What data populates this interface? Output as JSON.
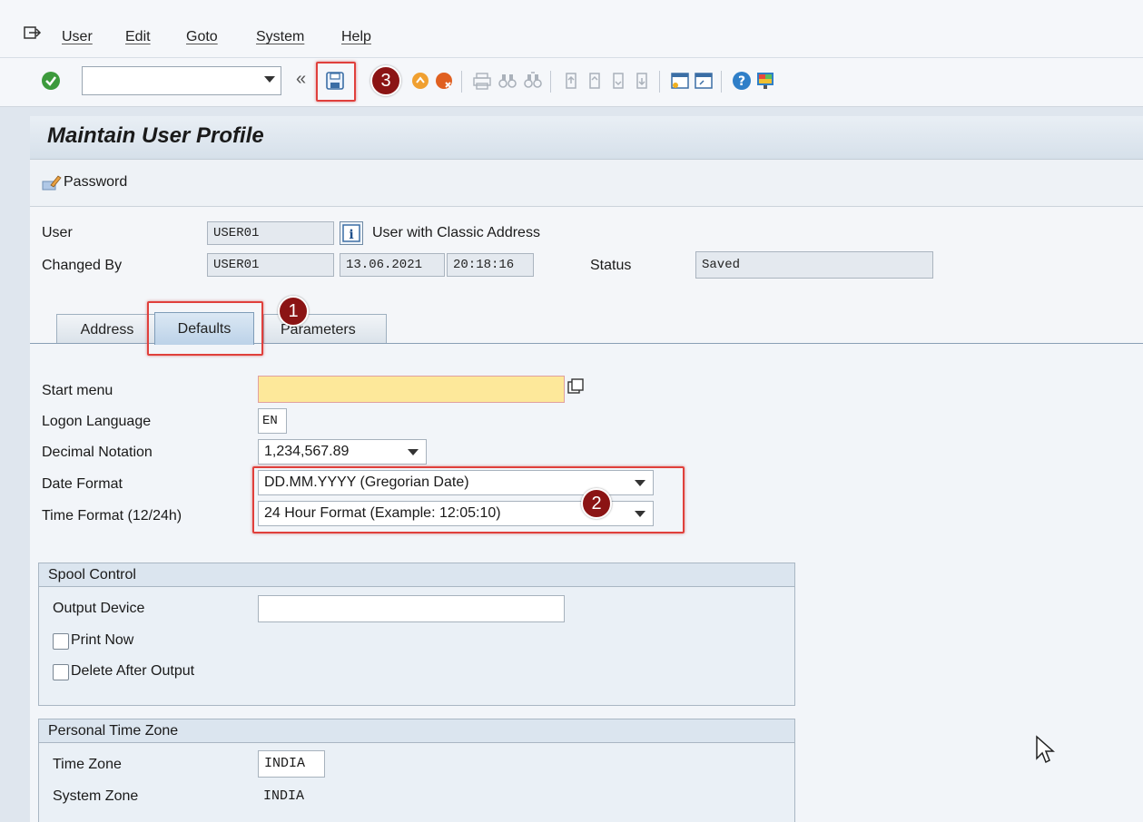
{
  "menubar": {
    "items": [
      "User",
      "Edit",
      "Goto",
      "System",
      "Help"
    ]
  },
  "toolbar": {
    "command_value": "",
    "icons": [
      "enter-icon",
      "back-icon",
      "save-icon",
      "exit-icon",
      "cancel-icon",
      "print-icon",
      "find-icon",
      "find-next-icon",
      "first-page-icon",
      "previous-page-icon",
      "next-page-icon",
      "last-page-icon",
      "new-session-icon",
      "shortcut-icon",
      "help-icon",
      "customize-layout-icon"
    ]
  },
  "page": {
    "title": "Maintain User Profile",
    "password_button": "Password"
  },
  "header_fields": {
    "user_label": "User",
    "user_value": "USER01",
    "user_description": "User with Classic Address",
    "changed_by_label": "Changed By",
    "changed_by_value": "USER01",
    "changed_date": "13.06.2021",
    "changed_time": "20:18:16",
    "status_label": "Status",
    "status_value": "Saved"
  },
  "tabs": [
    {
      "label": "Address",
      "active": false
    },
    {
      "label": "Defaults",
      "active": true
    },
    {
      "label": "Parameters",
      "active": false
    }
  ],
  "defaults": {
    "start_menu_label": "Start menu",
    "start_menu_value": "",
    "logon_language_label": "Logon Language",
    "logon_language_value": "EN",
    "decimal_notation_label": "Decimal Notation",
    "decimal_notation_value": "1,234,567.89",
    "date_format_label": "Date Format",
    "date_format_value": "DD.MM.YYYY (Gregorian Date)",
    "time_format_label": "Time Format (12/24h)",
    "time_format_value": "24 Hour Format (Example: 12:05:10)"
  },
  "spool_control": {
    "title": "Spool Control",
    "output_device_label": "Output Device",
    "output_device_value": "",
    "print_now_label": "Print Now",
    "print_now_checked": false,
    "delete_after_output_label": "Delete After Output",
    "delete_after_output_checked": false
  },
  "personal_time_zone": {
    "title": "Personal Time Zone",
    "time_zone_label": "Time Zone",
    "time_zone_value": "INDIA",
    "system_zone_label": "System Zone",
    "system_zone_value": "INDIA"
  },
  "annotations": {
    "step1": "1",
    "step2": "2",
    "step3": "3",
    "highlight_color": "#e0403c",
    "badge_color": "#8b1414"
  }
}
